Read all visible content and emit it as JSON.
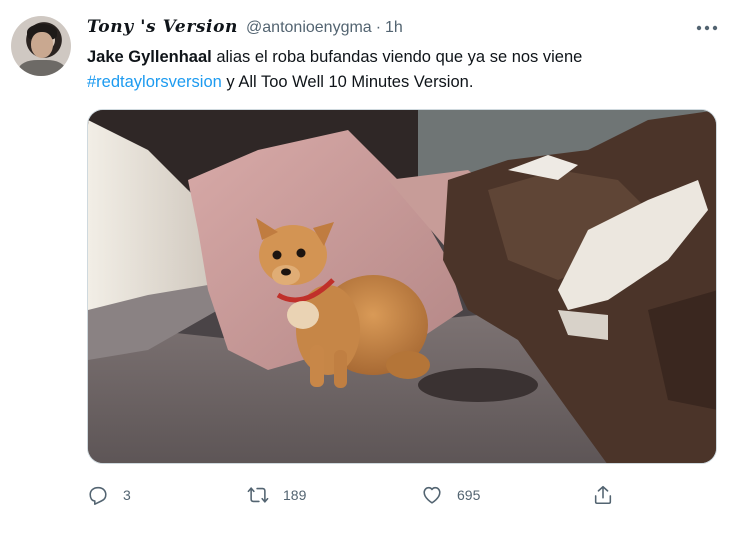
{
  "tweet": {
    "display_name": "Tony 's Version",
    "handle": "@antonioenygma",
    "separator": "·",
    "time": "1h",
    "text_bold": "Jake Gyllenhaal",
    "text_part1": " alias el roba bufandas viendo que ya se nos viene",
    "hashtag": "#redtaylorsversion",
    "text_part2": " y All Too Well 10 Minutes Version."
  },
  "icons": {
    "more": "more-dots-icon",
    "reply": "reply-icon",
    "retweet": "retweet-icon",
    "like": "heart-icon",
    "share": "share-icon"
  },
  "actions": {
    "replies": "3",
    "retweets": "189",
    "likes": "695"
  },
  "colors": {
    "hashtag": "#1d9bf0",
    "secondary_text": "#536471"
  }
}
